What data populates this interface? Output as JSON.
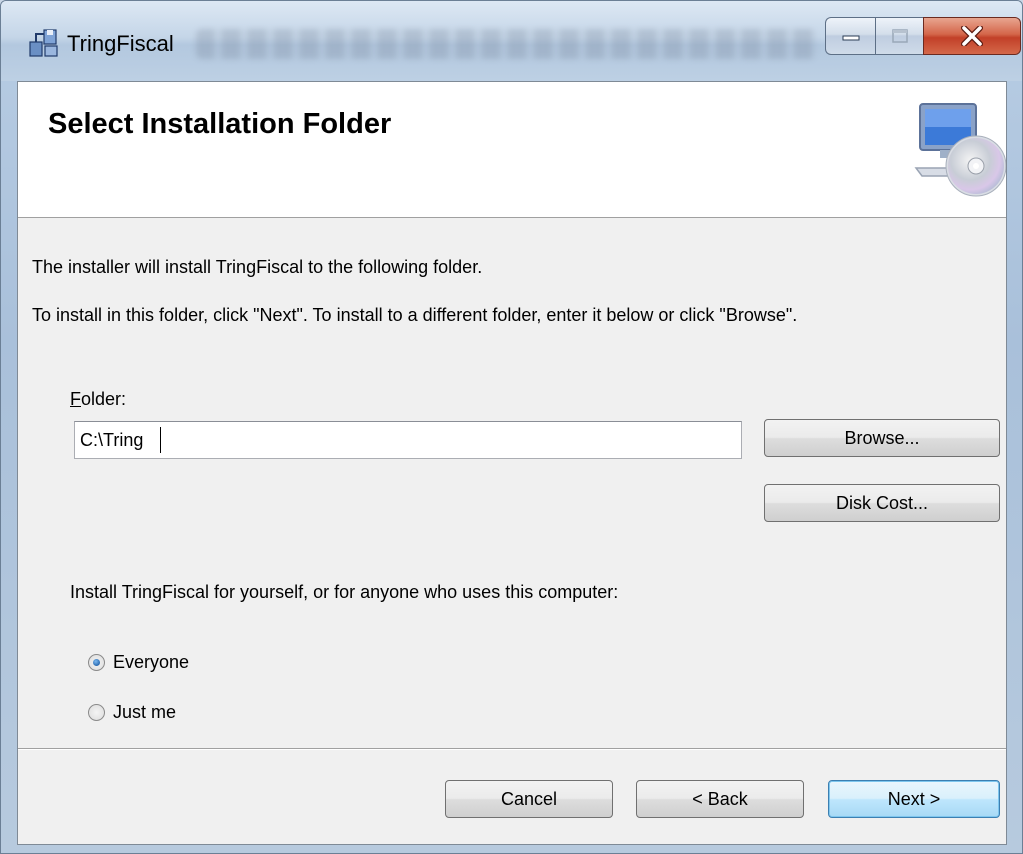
{
  "window": {
    "title": "TringFiscal"
  },
  "banner": {
    "title": "Select Installation Folder",
    "icon": "computer-disc-icon"
  },
  "body": {
    "line1": "The installer will install TringFiscal to the following folder.",
    "line2": "To install in this folder, click \"Next\". To install to a different folder, enter it below or click \"Browse\"."
  },
  "folder": {
    "label_hotkey": "F",
    "label_rest": "older:",
    "value": "C:\\Tring",
    "browse_label": "Browse...",
    "disk_cost_label": "Disk Cost..."
  },
  "install_for": {
    "prompt": "Install TringFiscal for yourself, or for anyone who uses this computer:",
    "options": [
      {
        "label": "Everyone",
        "selected": true
      },
      {
        "label": "Just me",
        "selected": false
      }
    ]
  },
  "footer": {
    "cancel_label": "Cancel",
    "back_label": "< Back",
    "next_label": "Next >"
  },
  "colors": {
    "close_button": "#c24028",
    "default_button_border": "#3c7fb1"
  }
}
